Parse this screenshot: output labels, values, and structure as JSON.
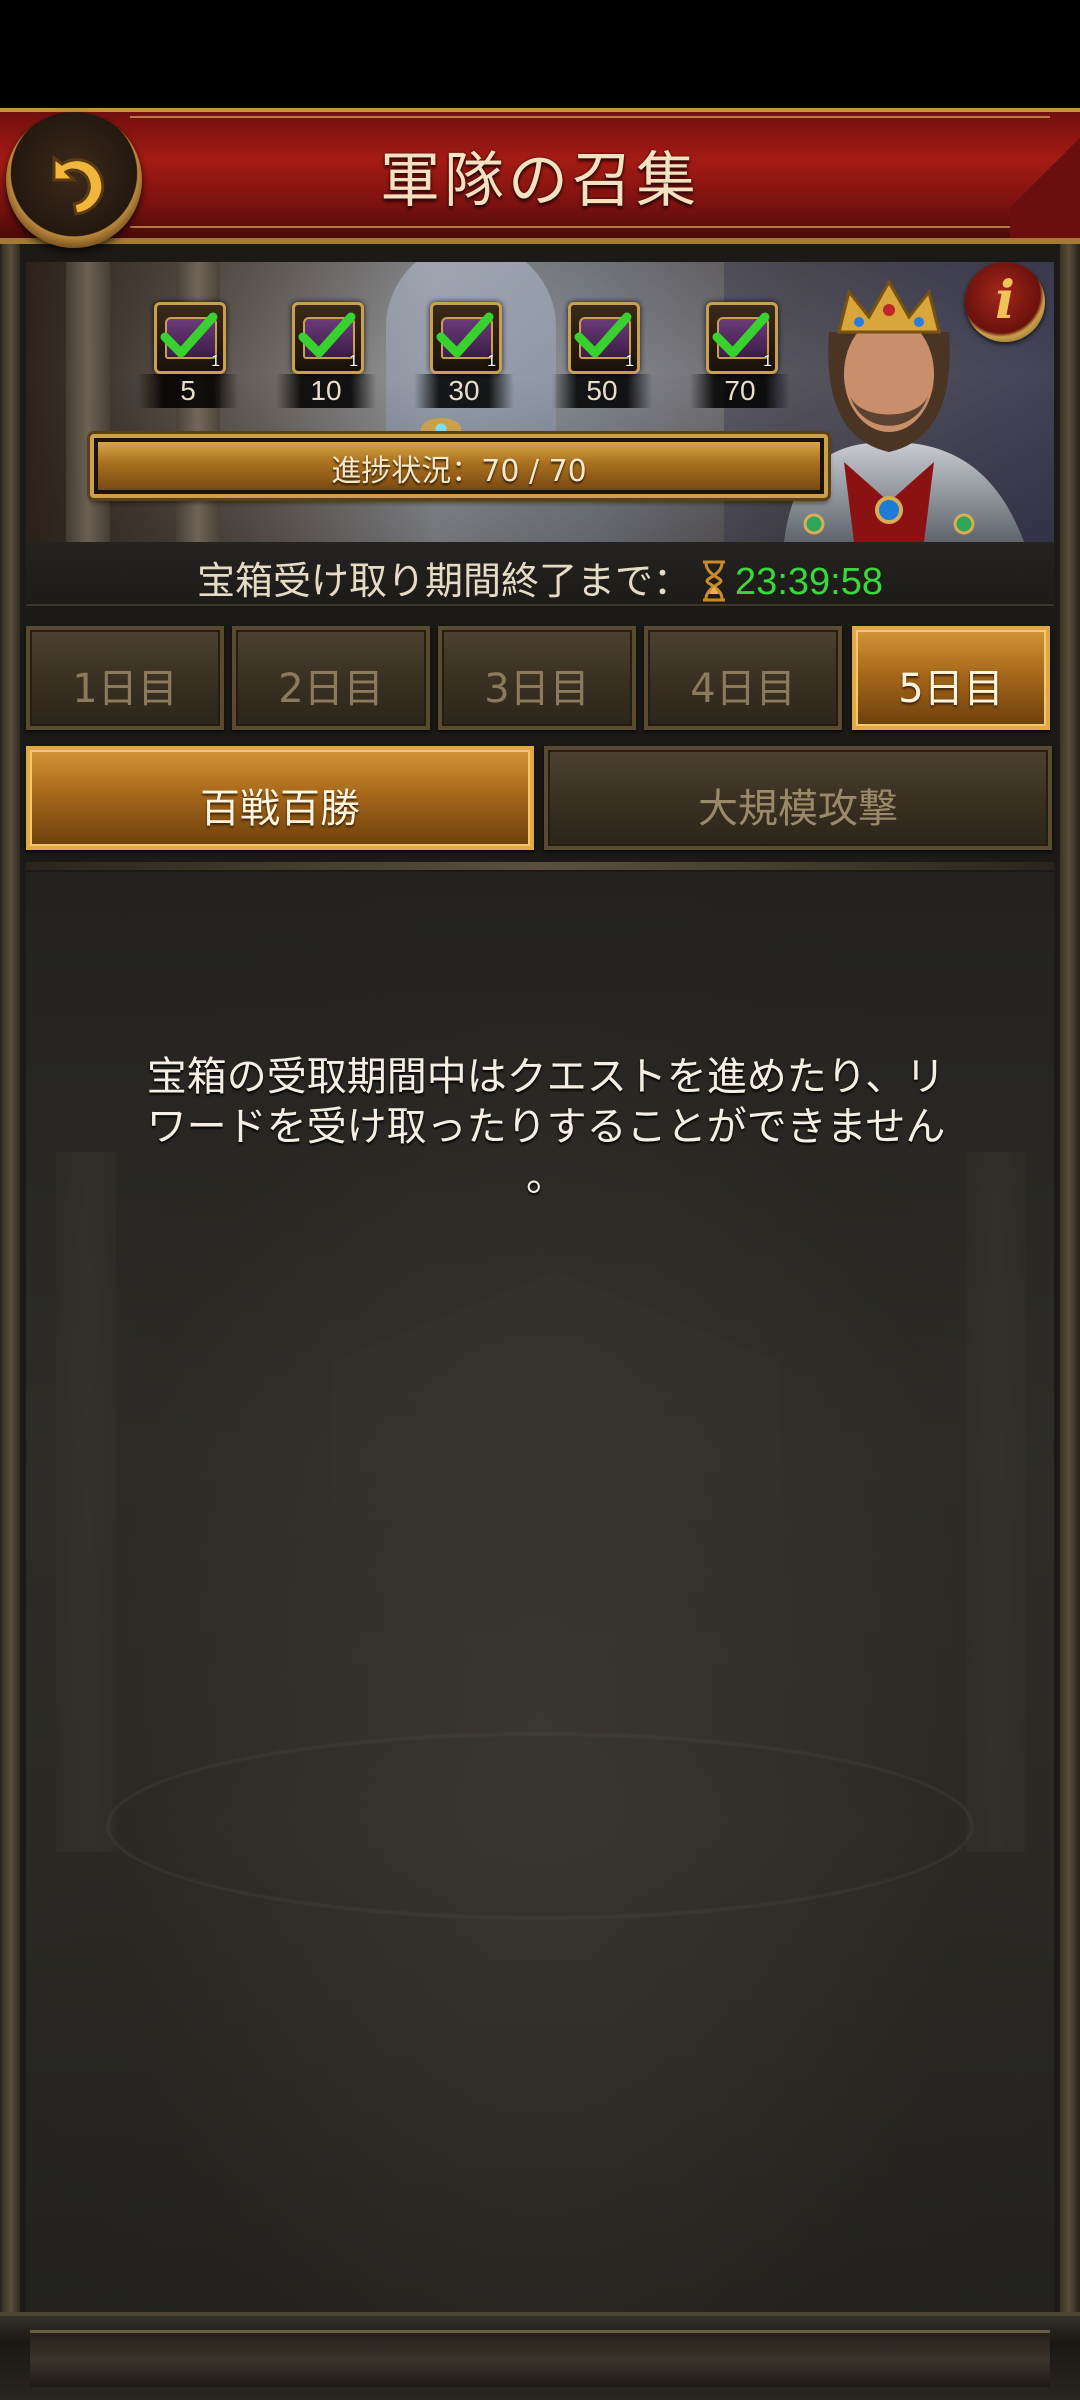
{
  "header": {
    "title": "軍隊の召集",
    "back_icon": "back-arrow-icon"
  },
  "banner": {
    "info_label": "i",
    "milestones": [
      {
        "threshold": "5",
        "chest_qty": "1",
        "claimed": true
      },
      {
        "threshold": "10",
        "chest_qty": "1",
        "claimed": true
      },
      {
        "threshold": "30",
        "chest_qty": "1",
        "claimed": true
      },
      {
        "threshold": "50",
        "chest_qty": "1",
        "claimed": true
      },
      {
        "threshold": "70",
        "chest_qty": "1",
        "claimed": true
      }
    ],
    "progress": {
      "label": "進捗状況：70 / 70",
      "current": 70,
      "max": 70
    }
  },
  "timer": {
    "label": "宝箱受け取り期間終了まで：",
    "value": "23:39:58",
    "value_color": "#38d93a"
  },
  "day_tabs": [
    {
      "label": "1日目",
      "active": false
    },
    {
      "label": "2日目",
      "active": false
    },
    {
      "label": "3日目",
      "active": false
    },
    {
      "label": "4日目",
      "active": false
    },
    {
      "label": "5日目",
      "active": true
    }
  ],
  "category_tabs": [
    {
      "label": "百戦百勝",
      "active": true
    },
    {
      "label": "大規模攻撃",
      "active": false
    }
  ],
  "content": {
    "message": "宝箱の受取期間中はクエストを進めたり、リ\nワードを受け取ったりすることができません\n。"
  },
  "colors": {
    "accent_gold": "#d29536",
    "header_red": "#a51b14",
    "timer_green": "#38d93a"
  }
}
